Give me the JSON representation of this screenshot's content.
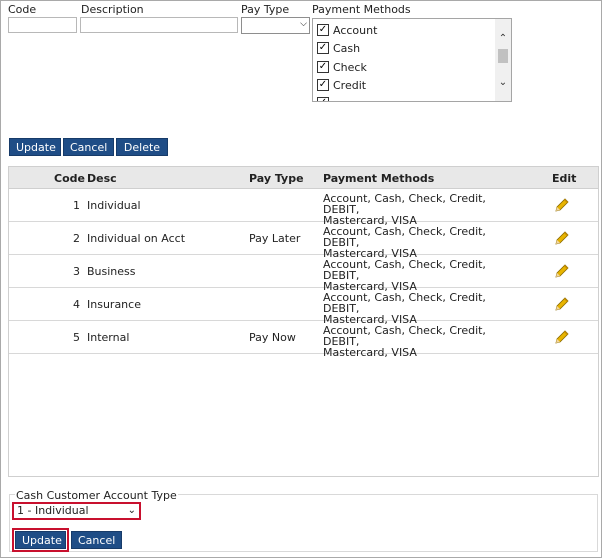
{
  "form": {
    "code_label": "Code",
    "description_label": "Description",
    "pay_type_label": "Pay Type",
    "payment_methods_label": "Payment Methods",
    "code_value": "",
    "description_value": "",
    "pay_type_value": "",
    "payment_methods": [
      {
        "label": "Account",
        "checked": true
      },
      {
        "label": "Cash",
        "checked": true
      },
      {
        "label": "Check",
        "checked": true
      },
      {
        "label": "Credit",
        "checked": true
      }
    ]
  },
  "buttons": {
    "update": "Update",
    "cancel": "Cancel",
    "delete": "Delete"
  },
  "table": {
    "headers": {
      "code": "Code",
      "desc": "Desc",
      "pay_type": "Pay Type",
      "payment_methods": "Payment Methods",
      "edit": "Edit"
    },
    "rows": [
      {
        "code": "1",
        "desc": "Individual",
        "pay_type": "",
        "methods_line1": "Account, Cash, Check, Credit, DEBIT,",
        "methods_line2": "Mastercard, VISA"
      },
      {
        "code": "2",
        "desc": "Individual on Acct",
        "pay_type": "Pay Later",
        "methods_line1": "Account, Cash, Check, Credit, DEBIT,",
        "methods_line2": "Mastercard, VISA"
      },
      {
        "code": "3",
        "desc": "Business",
        "pay_type": "",
        "methods_line1": "Account, Cash, Check, Credit, DEBIT,",
        "methods_line2": "Mastercard, VISA"
      },
      {
        "code": "4",
        "desc": "Insurance",
        "pay_type": "",
        "methods_line1": "Account, Cash, Check, Credit, DEBIT,",
        "methods_line2": "Mastercard, VISA"
      },
      {
        "code": "5",
        "desc": "Internal",
        "pay_type": "Pay Now",
        "methods_line1": "Account, Cash, Check, Credit, DEBIT,",
        "methods_line2": "Mastercard, VISA"
      }
    ]
  },
  "cash_customer": {
    "label": "Cash Customer Account Type",
    "selected": "1 - Individual",
    "update_label": "Update",
    "cancel_label": "Cancel"
  },
  "colors": {
    "button_bg": "#1f4d86",
    "highlight": "#c8102e",
    "pencil": "#d9a400"
  },
  "icons": {
    "edit": "pencil-icon",
    "checkbox": "checkmark",
    "scroll_up": "chevron-up-icon",
    "scroll_down": "chevron-down-icon"
  }
}
